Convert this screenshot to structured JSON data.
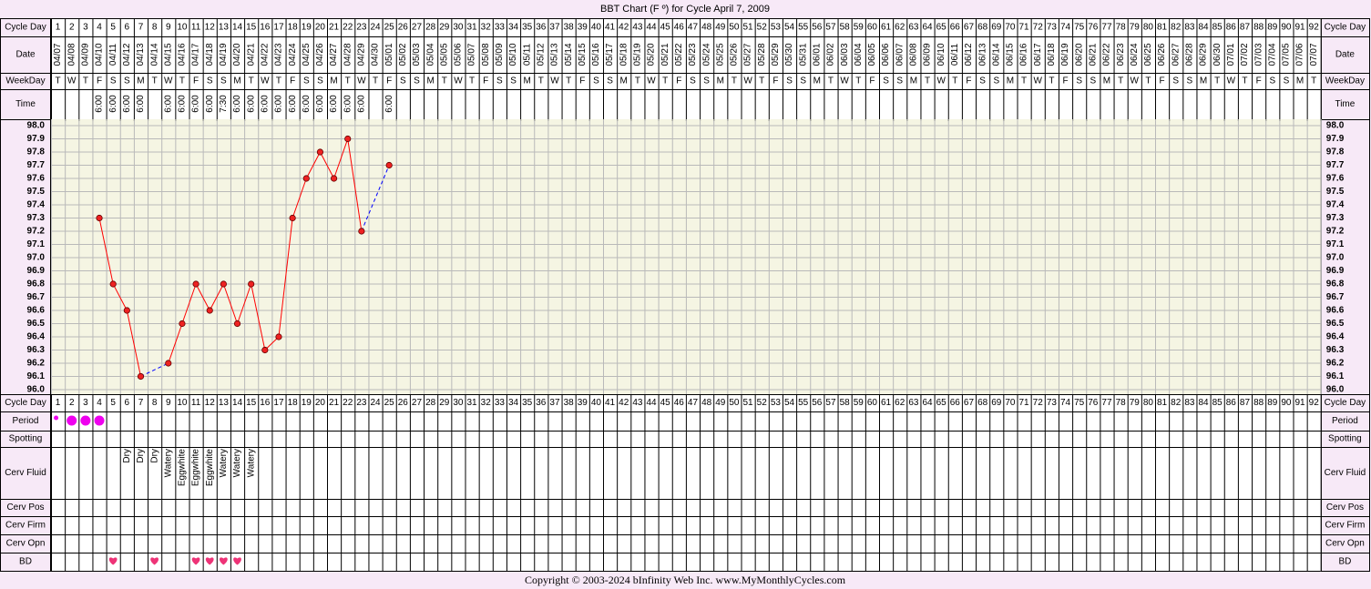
{
  "chart_data": {
    "type": "line",
    "title": "BBT Chart (F º) for Cycle April 7, 2009",
    "ylim": [
      96.0,
      98.0
    ],
    "y_ticks": [
      "98.0",
      "97.9",
      "97.8",
      "97.7",
      "97.6",
      "97.5",
      "97.4",
      "97.3",
      "97.2",
      "97.1",
      "97.0",
      "96.9",
      "96.8",
      "96.7",
      "96.6",
      "96.5",
      "96.4",
      "96.3",
      "96.2",
      "96.1",
      "96.0"
    ],
    "cycle_days": [
      1,
      2,
      3,
      4,
      5,
      6,
      7,
      8,
      9,
      10,
      11,
      12,
      13,
      14,
      15,
      16,
      17,
      18,
      19,
      20,
      21,
      22,
      23,
      24,
      25,
      26,
      27,
      28,
      29,
      30,
      31,
      32,
      33,
      34,
      35,
      36,
      37,
      38,
      39,
      40,
      41,
      42,
      43,
      44,
      45,
      46,
      47,
      48,
      49,
      50,
      51,
      52,
      53,
      54,
      55,
      56,
      57,
      58,
      59,
      60,
      61,
      62,
      63,
      64,
      65,
      66,
      67,
      68,
      69,
      70,
      71,
      72,
      73,
      74,
      75,
      76,
      77,
      78,
      79,
      80,
      81,
      82,
      83,
      84,
      85,
      86,
      87,
      88,
      89,
      90,
      91,
      92
    ],
    "dates": [
      "04/07",
      "04/08",
      "04/09",
      "04/10",
      "04/11",
      "04/12",
      "04/13",
      "04/14",
      "04/15",
      "04/16",
      "04/17",
      "04/18",
      "04/19",
      "04/20",
      "04/21",
      "04/22",
      "04/23",
      "04/24",
      "04/25",
      "04/26",
      "04/27",
      "04/28",
      "04/29",
      "04/30",
      "05/01",
      "05/02",
      "05/03",
      "05/04",
      "05/05",
      "05/06",
      "05/07",
      "05/08",
      "05/09",
      "05/10",
      "05/11",
      "05/12",
      "05/13",
      "05/14",
      "05/15",
      "05/16",
      "05/17",
      "05/18",
      "05/19",
      "05/20",
      "05/21",
      "05/22",
      "05/23",
      "05/24",
      "05/25",
      "05/26",
      "05/27",
      "05/28",
      "05/29",
      "05/30",
      "05/31",
      "06/01",
      "06/02",
      "06/03",
      "06/04",
      "06/05",
      "06/06",
      "06/07",
      "06/08",
      "06/09",
      "06/10",
      "06/11",
      "06/12",
      "06/13",
      "06/14",
      "06/15",
      "06/16",
      "06/17",
      "06/18",
      "06/19",
      "06/20",
      "06/21",
      "06/22",
      "06/23",
      "06/24",
      "06/25",
      "06/26",
      "06/27",
      "06/28",
      "06/29",
      "06/30",
      "07/01",
      "07/02",
      "07/03",
      "07/04",
      "07/05",
      "07/06",
      "07/07"
    ],
    "weekday_cycle": [
      "T",
      "W",
      "T",
      "F",
      "S",
      "S",
      "M"
    ],
    "times": [
      "",
      "",
      "",
      "6:00",
      "6:00",
      "6:00",
      "6:00",
      "",
      "6:00",
      "6:00",
      "6:00",
      "6:00",
      "7:30",
      "6:00",
      "6:00",
      "6:00",
      "6:00",
      "6:00",
      "6:00",
      "6:00",
      "6:00",
      "6:00",
      "6:00",
      "",
      "6:00"
    ],
    "series": [
      {
        "values": [
          null,
          null,
          null,
          97.3,
          96.8,
          96.6,
          96.1,
          null,
          96.2,
          96.5,
          96.8,
          96.6,
          96.8,
          96.5,
          96.8,
          96.3,
          96.4,
          97.3,
          97.6,
          97.8,
          97.6,
          97.9,
          97.2,
          null,
          97.7
        ]
      }
    ],
    "period": {
      "1": "spot",
      "2": "heavy",
      "3": "heavy",
      "4": "heavy"
    },
    "cerv_fluid": {
      "6": "Dry",
      "7": "Dry",
      "8": "Dry",
      "9": "Watery",
      "10": "Eggwhite",
      "11": "Eggwhite",
      "12": "Eggwhite",
      "13": "Watery",
      "14": "Watery",
      "15": "Watery"
    },
    "bd_days": [
      5,
      8,
      11,
      12,
      13,
      14
    ]
  },
  "labels": {
    "cycle_day": "Cycle Day",
    "date": "Date",
    "weekday": "WeekDay",
    "time": "Time",
    "period": "Period",
    "spotting": "Spotting",
    "cerv_fluid": "Cerv Fluid",
    "cerv_pos": "Cerv Pos",
    "cerv_firm": "Cerv Firm",
    "cerv_opn": "Cerv Opn",
    "bd": "BD"
  },
  "footer": "Copyright © 2003-2024 bInfinity Web Inc.     www.MyMonthlyCycles.com",
  "colors": {
    "background": "#f7e9f7",
    "grid_bg": "#f5f5e3",
    "line": "#ff0000",
    "dot": "#ee2222",
    "dash": "#0000ff",
    "period": "#ee00ee",
    "heart": "#ee3377"
  },
  "icons": {
    "bd": "heart-icon",
    "period": "period-dot-icon"
  }
}
